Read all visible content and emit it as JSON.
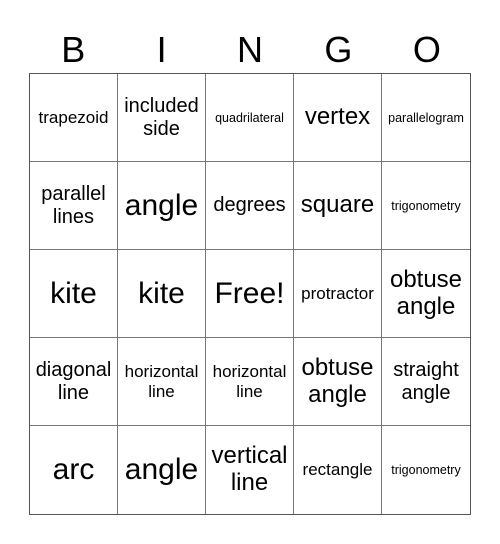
{
  "title_letters": [
    "B",
    "I",
    "N",
    "G",
    "O"
  ],
  "cells": [
    [
      "trapezoid",
      "included side",
      "quadrilateral",
      "vertex",
      "parallelogram"
    ],
    [
      "parallel lines",
      "angle",
      "degrees",
      "square",
      "trigonometry"
    ],
    [
      "kite",
      "kite",
      "Free!",
      "protractor",
      "obtuse angle"
    ],
    [
      "diagonal line",
      "horizontal line",
      "horizontal line",
      "obtuse angle",
      "straight angle"
    ],
    [
      "arc",
      "angle",
      "vertical line",
      "rectangle",
      "trigonometry"
    ]
  ],
  "free_space": {
    "row": 2,
    "col": 2,
    "label": "Free!"
  }
}
